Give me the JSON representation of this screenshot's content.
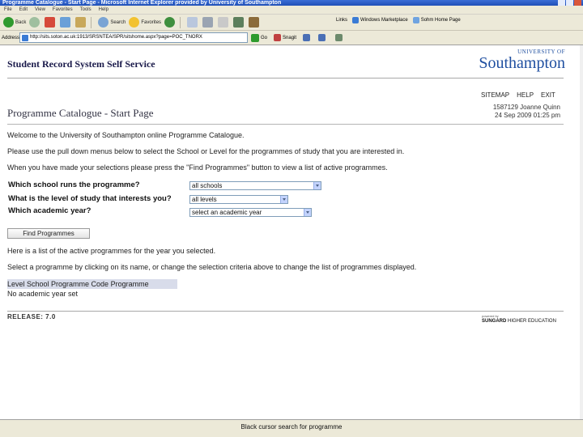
{
  "window": {
    "title": "Programme Catalogue - Start Page - Microsoft Internet Explorer provided by University of Southampton"
  },
  "menu": [
    "File",
    "Edit",
    "View",
    "Favorites",
    "Tools",
    "Help"
  ],
  "toolbar": {
    "back": "Back",
    "search": "Search",
    "favorites": "Favorites",
    "links": "Links",
    "link1": "Windows Marketplace",
    "link2": "Sohm Home Page"
  },
  "addressbar": {
    "label": "Address",
    "url": "http://sits.soton.ac.uk:1913/SRSNTEA/SPR/sitshome.aspx?page=POC_TNORX",
    "go": "Go",
    "snagit": "Snagit"
  },
  "header": {
    "system_title": "Student Record System Self Service",
    "logo_top": "UNIVERSITY OF",
    "logo_main": "Southampton"
  },
  "toplinks": {
    "sitemap": "SITEMAP",
    "help": "HELP",
    "exit": "EXIT"
  },
  "user": {
    "line1": "1587129 Joanne Quinn",
    "line2": "24 Sep 2009 01:25 pm"
  },
  "page": {
    "title": "Programme Catalogue - Start Page",
    "welcome": "Welcome to the University of Southampton online Programme Catalogue.",
    "instruction": "Please use the pull down menus below to select the School or Level for the programmes of study that you are interested in.",
    "instruction2": "When you have made your selections please press the \"Find Programmes\" button to view a list of active programmes.",
    "q_school": "Which school runs the programme?",
    "q_level": "What is the level of study that interests you?",
    "q_year": "Which academic year?",
    "school_value": "all schools",
    "level_value": "all levels",
    "year_value": "select an academic year",
    "find_button": "Find Programmes",
    "list_intro": "Here is a list of the active programmes for the year you selected.",
    "list_help": "Select a programme by clicking on its name, or change the selection criteria above to change the list of programmes displayed.",
    "table_header": "Level School Programme Code Programme",
    "no_year": "No academic year set"
  },
  "footer": {
    "release": "RELEASE: 7.0",
    "powered": "powered by",
    "brand": "SUNGARD",
    "brand_rest": "HIGHER EDUCATION"
  },
  "statusbar": {
    "text": "Black cursor search for programme"
  }
}
